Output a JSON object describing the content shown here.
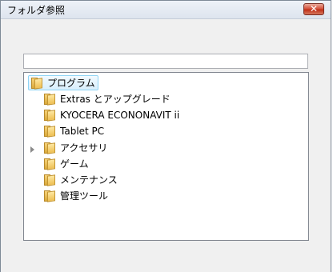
{
  "dialog": {
    "title": "フォルダ参照",
    "close_glyph": "✕"
  },
  "path_field": {
    "value": ""
  },
  "tree": {
    "root": {
      "label": "プログラム",
      "icon": "folder-icon",
      "selected": true
    },
    "items": [
      {
        "label": "Extras とアップグレード",
        "icon": "folder-icon",
        "expandable": false
      },
      {
        "label": "KYOCERA ECONONAVIT ii",
        "icon": "folder-icon",
        "expandable": false
      },
      {
        "label": "Tablet PC",
        "icon": "folder-icon",
        "expandable": false
      },
      {
        "label": "アクセサリ",
        "icon": "folder-icon",
        "expandable": true
      },
      {
        "label": "ゲーム",
        "icon": "folder-icon",
        "expandable": false
      },
      {
        "label": "メンテナンス",
        "icon": "folder-icon",
        "expandable": false
      },
      {
        "label": "管理ツール",
        "icon": "folder-icon",
        "expandable": false
      }
    ]
  },
  "colors": {
    "selection_border": "#8fd4f5",
    "close_button": "#c03018",
    "folder": "#eebf53"
  }
}
